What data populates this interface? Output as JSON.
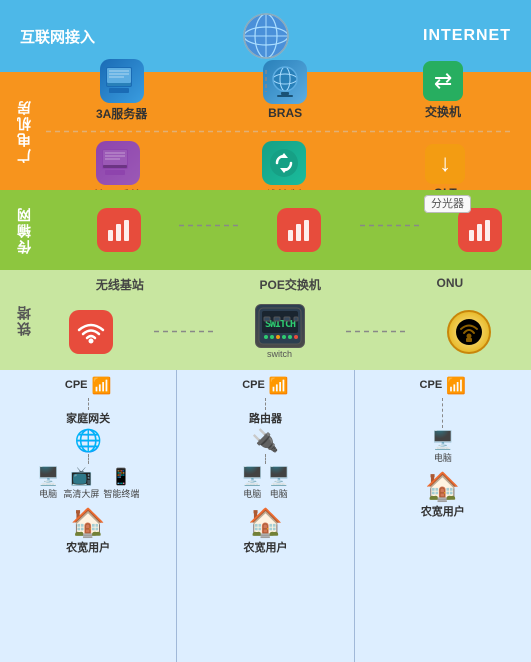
{
  "rows": {
    "internet": {
      "label": "互联网接入",
      "internet_label": "INTERNET"
    },
    "broadcast": {
      "label": "广电机房",
      "top_items": [
        {
          "id": "3a-server",
          "name": "3A服务器"
        },
        {
          "id": "bras",
          "name": "BRAS"
        },
        {
          "id": "switch-machine",
          "name": "交换机"
        }
      ],
      "bottom_items": [
        {
          "id": "manage-sys",
          "name": "管理系统"
        },
        {
          "id": "wifi-ctrl",
          "name": "无线控制器"
        },
        {
          "id": "olt",
          "name": "OLT"
        }
      ]
    },
    "transport": {
      "label": "传输网",
      "splitter_label": "分光器",
      "items": [
        {
          "id": "trans1",
          "name": ""
        },
        {
          "id": "trans2",
          "name": ""
        },
        {
          "id": "trans3",
          "name": ""
        }
      ]
    },
    "tower": {
      "label": "铁塔",
      "items": [
        {
          "id": "wifi-base",
          "name": "无线基站"
        },
        {
          "id": "poe-switch",
          "name": "POE交换机"
        },
        {
          "id": "onu",
          "name": "ONU"
        }
      ],
      "switch_label": "switch"
    },
    "users": {
      "columns": [
        {
          "id": "col1",
          "cpe_label": "CPE",
          "gateway_label": "家庭网关",
          "devices": [
            "电脑",
            "高清大屏",
            "智能终端"
          ],
          "user_label": "农宽用户"
        },
        {
          "id": "col2",
          "cpe_label": "CPE",
          "gateway_label": "路由器",
          "devices": [
            "电脑",
            "电脑"
          ],
          "user_label": "农宽用户"
        },
        {
          "id": "col3",
          "cpe_label": "CPE",
          "gateway_label": "",
          "devices": [
            "电脑"
          ],
          "user_label": "农宽用户"
        }
      ]
    }
  }
}
